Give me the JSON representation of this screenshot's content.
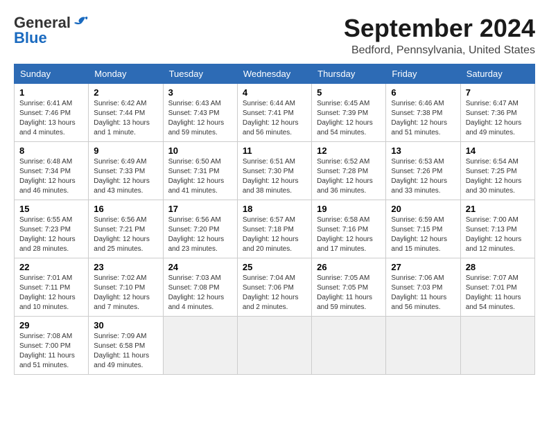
{
  "logo": {
    "text_general": "General",
    "text_blue": "Blue"
  },
  "header": {
    "title": "September 2024",
    "subtitle": "Bedford, Pennsylvania, United States"
  },
  "weekdays": [
    "Sunday",
    "Monday",
    "Tuesday",
    "Wednesday",
    "Thursday",
    "Friday",
    "Saturday"
  ],
  "weeks": [
    [
      {
        "day": "1",
        "sunrise": "6:41 AM",
        "sunset": "7:46 PM",
        "daylight": "13 hours and 4 minutes."
      },
      {
        "day": "2",
        "sunrise": "6:42 AM",
        "sunset": "7:44 PM",
        "daylight": "13 hours and 1 minute."
      },
      {
        "day": "3",
        "sunrise": "6:43 AM",
        "sunset": "7:43 PM",
        "daylight": "12 hours and 59 minutes."
      },
      {
        "day": "4",
        "sunrise": "6:44 AM",
        "sunset": "7:41 PM",
        "daylight": "12 hours and 56 minutes."
      },
      {
        "day": "5",
        "sunrise": "6:45 AM",
        "sunset": "7:39 PM",
        "daylight": "12 hours and 54 minutes."
      },
      {
        "day": "6",
        "sunrise": "6:46 AM",
        "sunset": "7:38 PM",
        "daylight": "12 hours and 51 minutes."
      },
      {
        "day": "7",
        "sunrise": "6:47 AM",
        "sunset": "7:36 PM",
        "daylight": "12 hours and 49 minutes."
      }
    ],
    [
      {
        "day": "8",
        "sunrise": "6:48 AM",
        "sunset": "7:34 PM",
        "daylight": "12 hours and 46 minutes."
      },
      {
        "day": "9",
        "sunrise": "6:49 AM",
        "sunset": "7:33 PM",
        "daylight": "12 hours and 43 minutes."
      },
      {
        "day": "10",
        "sunrise": "6:50 AM",
        "sunset": "7:31 PM",
        "daylight": "12 hours and 41 minutes."
      },
      {
        "day": "11",
        "sunrise": "6:51 AM",
        "sunset": "7:30 PM",
        "daylight": "12 hours and 38 minutes."
      },
      {
        "day": "12",
        "sunrise": "6:52 AM",
        "sunset": "7:28 PM",
        "daylight": "12 hours and 36 minutes."
      },
      {
        "day": "13",
        "sunrise": "6:53 AM",
        "sunset": "7:26 PM",
        "daylight": "12 hours and 33 minutes."
      },
      {
        "day": "14",
        "sunrise": "6:54 AM",
        "sunset": "7:25 PM",
        "daylight": "12 hours and 30 minutes."
      }
    ],
    [
      {
        "day": "15",
        "sunrise": "6:55 AM",
        "sunset": "7:23 PM",
        "daylight": "12 hours and 28 minutes."
      },
      {
        "day": "16",
        "sunrise": "6:56 AM",
        "sunset": "7:21 PM",
        "daylight": "12 hours and 25 minutes."
      },
      {
        "day": "17",
        "sunrise": "6:56 AM",
        "sunset": "7:20 PM",
        "daylight": "12 hours and 23 minutes."
      },
      {
        "day": "18",
        "sunrise": "6:57 AM",
        "sunset": "7:18 PM",
        "daylight": "12 hours and 20 minutes."
      },
      {
        "day": "19",
        "sunrise": "6:58 AM",
        "sunset": "7:16 PM",
        "daylight": "12 hours and 17 minutes."
      },
      {
        "day": "20",
        "sunrise": "6:59 AM",
        "sunset": "7:15 PM",
        "daylight": "12 hours and 15 minutes."
      },
      {
        "day": "21",
        "sunrise": "7:00 AM",
        "sunset": "7:13 PM",
        "daylight": "12 hours and 12 minutes."
      }
    ],
    [
      {
        "day": "22",
        "sunrise": "7:01 AM",
        "sunset": "7:11 PM",
        "daylight": "12 hours and 10 minutes."
      },
      {
        "day": "23",
        "sunrise": "7:02 AM",
        "sunset": "7:10 PM",
        "daylight": "12 hours and 7 minutes."
      },
      {
        "day": "24",
        "sunrise": "7:03 AM",
        "sunset": "7:08 PM",
        "daylight": "12 hours and 4 minutes."
      },
      {
        "day": "25",
        "sunrise": "7:04 AM",
        "sunset": "7:06 PM",
        "daylight": "12 hours and 2 minutes."
      },
      {
        "day": "26",
        "sunrise": "7:05 AM",
        "sunset": "7:05 PM",
        "daylight": "11 hours and 59 minutes."
      },
      {
        "day": "27",
        "sunrise": "7:06 AM",
        "sunset": "7:03 PM",
        "daylight": "11 hours and 56 minutes."
      },
      {
        "day": "28",
        "sunrise": "7:07 AM",
        "sunset": "7:01 PM",
        "daylight": "11 hours and 54 minutes."
      }
    ],
    [
      {
        "day": "29",
        "sunrise": "7:08 AM",
        "sunset": "7:00 PM",
        "daylight": "11 hours and 51 minutes."
      },
      {
        "day": "30",
        "sunrise": "7:09 AM",
        "sunset": "6:58 PM",
        "daylight": "11 hours and 49 minutes."
      },
      null,
      null,
      null,
      null,
      null
    ]
  ],
  "labels": {
    "sunrise": "Sunrise:",
    "sunset": "Sunset:",
    "daylight": "Daylight:"
  }
}
